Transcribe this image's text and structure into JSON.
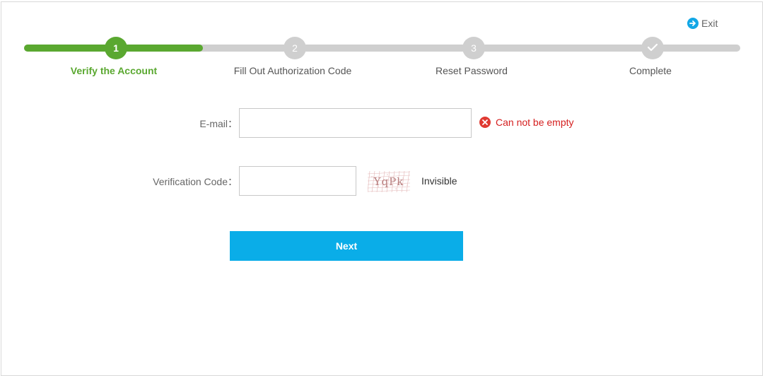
{
  "header": {
    "exit_label": "Exit",
    "exit_icon": "arrow-right-circle-icon"
  },
  "stepper": {
    "progress_fraction": 0.25,
    "active_color": "#5aa830",
    "inactive_color": "#cfcfcf",
    "steps": [
      {
        "number": "1",
        "label": "Verify the Account",
        "state": "active"
      },
      {
        "number": "2",
        "label": "Fill Out Authorization Code",
        "state": "pending"
      },
      {
        "number": "3",
        "label": "Reset Password",
        "state": "pending"
      },
      {
        "number": "",
        "label": "Complete",
        "state": "pending",
        "icon": "checkmark-icon"
      }
    ]
  },
  "form": {
    "email": {
      "label": "E-mail：",
      "value": "",
      "placeholder": "",
      "error": "Can not be empty",
      "error_icon": "close-circle-icon"
    },
    "verification": {
      "label": "Verification Code：",
      "value": "",
      "placeholder": "",
      "captcha_text": "YqPk",
      "refresh_label": "Invisible"
    },
    "next_label": "Next"
  },
  "colors": {
    "primary": "#0aade8",
    "success": "#5aa830",
    "error": "#d51f1f"
  }
}
